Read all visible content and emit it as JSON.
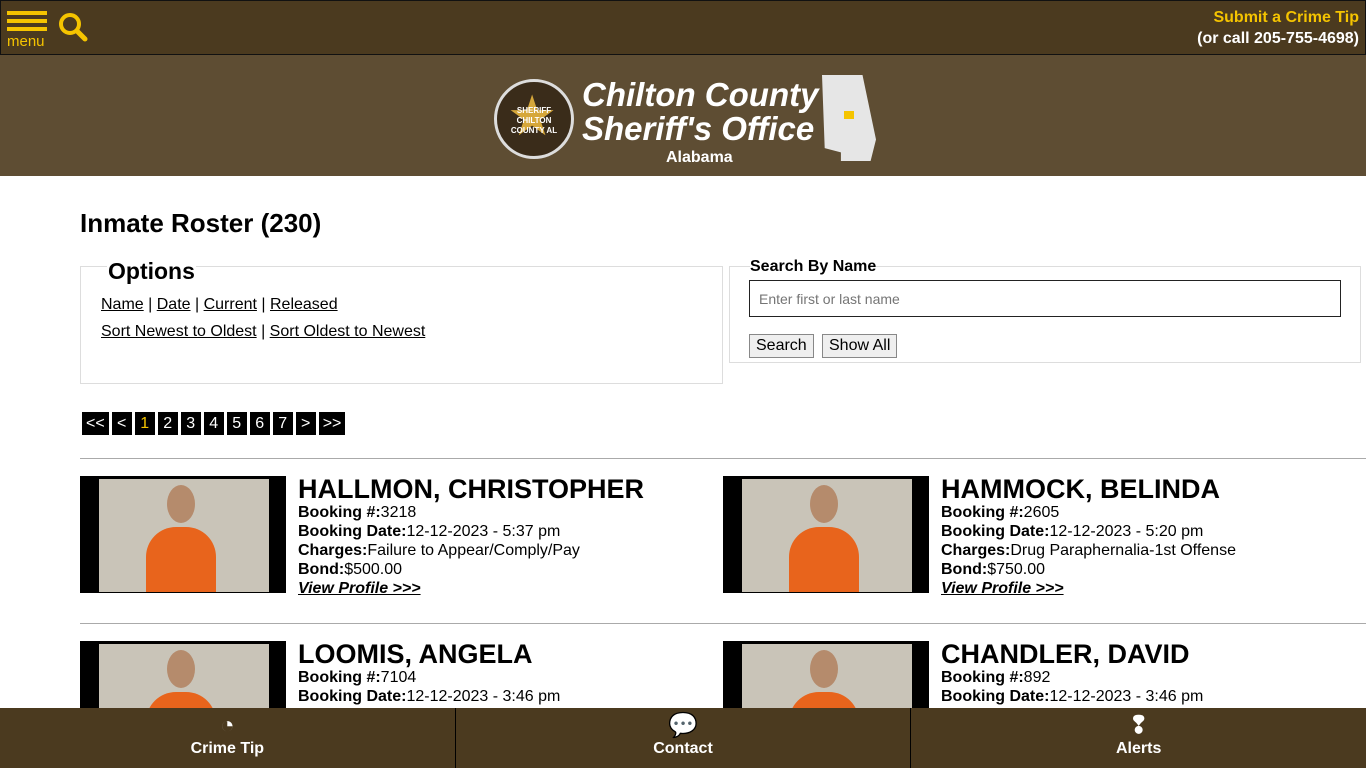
{
  "topbar": {
    "menu_label": "menu",
    "tip_label": "Submit a Crime Tip",
    "tip_phone": "(or call 205-755-4698)"
  },
  "header": {
    "title_line1": "Chilton County",
    "title_line2": "Sheriff's Office",
    "subtitle": "Alabama",
    "badge_text": "SHERIFF CHILTON COUNTY AL"
  },
  "page": {
    "title": "Inmate Roster (230)"
  },
  "options": {
    "legend": "Options",
    "sort_links": [
      "Name",
      "Date",
      "Current",
      "Released"
    ],
    "order_links": [
      "Sort Newest to Oldest",
      "Sort Oldest to Newest"
    ]
  },
  "search": {
    "legend": "Search By Name",
    "placeholder": "Enter first or last name",
    "search_label": "Search",
    "show_all_label": "Show All"
  },
  "pagination": {
    "first": "<<",
    "prev": "<",
    "pages": [
      "1",
      "2",
      "3",
      "4",
      "5",
      "6",
      "7"
    ],
    "current": "1",
    "next": ">",
    "last": ">>"
  },
  "labels": {
    "booking_no": "Booking #:",
    "booking_date": "Booking Date:",
    "charges": "Charges:",
    "bond": "Bond:",
    "view_profile": "View Profile >>>"
  },
  "inmates": [
    {
      "name": "HALLMON, CHRISTOPHER",
      "booking_no": "3218",
      "booking_date": "12-12-2023 - 5:37 pm",
      "charges": "Failure to Appear/Comply/Pay",
      "bond": "$500.00"
    },
    {
      "name": "HAMMOCK, BELINDA",
      "booking_no": "2605",
      "booking_date": "12-12-2023 - 5:20 pm",
      "charges": "Drug Paraphernalia-1st Offense",
      "bond": "$750.00"
    },
    {
      "name": "LOOMIS, ANGELA",
      "booking_no": "7104",
      "booking_date": "12-12-2023 - 3:46 pm"
    },
    {
      "name": "CHANDLER, DAVID",
      "booking_no": "892",
      "booking_date": "12-12-2023 - 3:46 pm"
    }
  ],
  "footer": {
    "items": [
      "Crime Tip",
      "Contact",
      "Alerts"
    ]
  },
  "colors": {
    "brand_brown": "#4b3a1f",
    "header_brown": "#5e4d33",
    "accent_yellow": "#f5c400"
  }
}
